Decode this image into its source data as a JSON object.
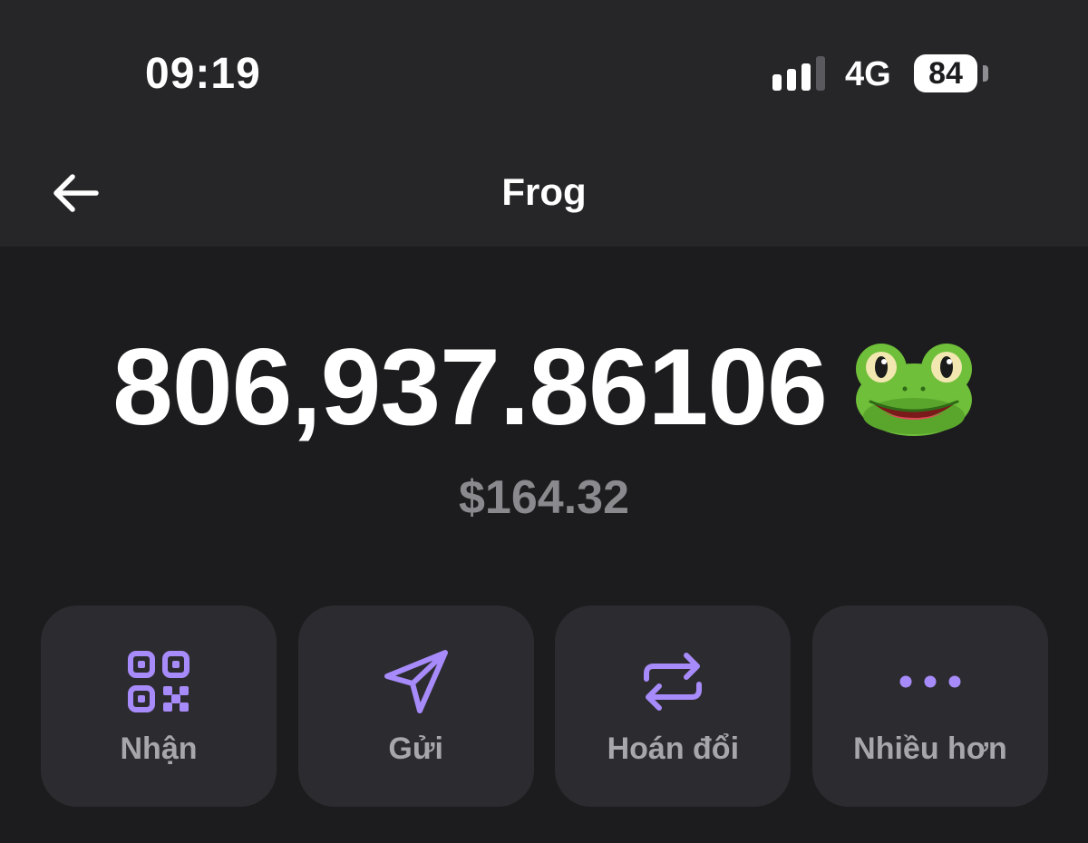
{
  "status_bar": {
    "time": "09:19",
    "network": "4G",
    "battery": "84"
  },
  "nav": {
    "title": "Frog"
  },
  "balance": {
    "amount": "806,937.86106",
    "fiat": "$164.32",
    "token_icon": "frog-emoji"
  },
  "actions": [
    {
      "label": "Nhận",
      "icon": "qr-code-icon"
    },
    {
      "label": "Gửi",
      "icon": "send-icon"
    },
    {
      "label": "Hoán đổi",
      "icon": "swap-icon"
    },
    {
      "label": "Nhiều hơn",
      "icon": "more-icon"
    }
  ],
  "colors": {
    "background": "#1c1c1e",
    "header": "#262628",
    "card": "#2c2c30",
    "accent": "#a78bfa",
    "muted_text": "#8a8a8e"
  }
}
